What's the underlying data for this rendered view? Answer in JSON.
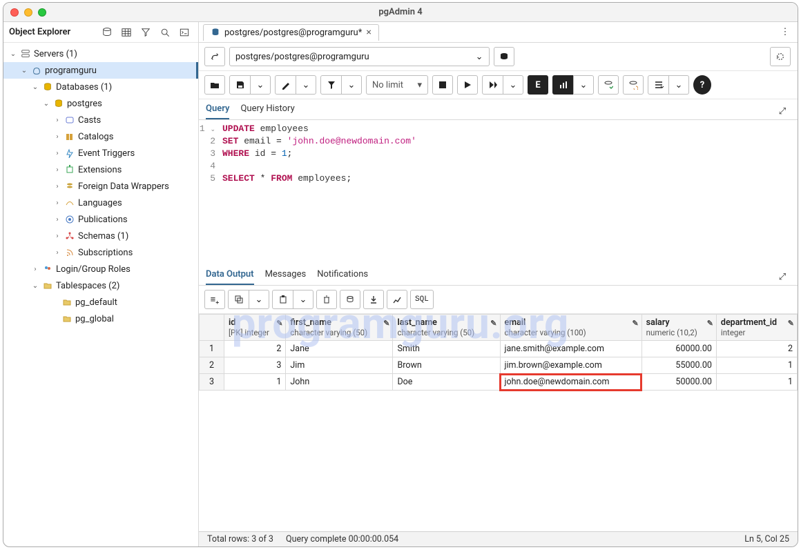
{
  "window": {
    "title": "pgAdmin 4"
  },
  "sidebar": {
    "title": "Object Explorer",
    "nodes": {
      "servers": "Servers (1)",
      "server1": "programguru",
      "databases": "Databases (1)",
      "db": "postgres",
      "casts": "Casts",
      "catalogs": "Catalogs",
      "event_triggers": "Event Triggers",
      "extensions": "Extensions",
      "fdw": "Foreign Data Wrappers",
      "languages": "Languages",
      "publications": "Publications",
      "schemas": "Schemas (1)",
      "subscriptions": "Subscriptions",
      "login_roles": "Login/Group Roles",
      "tablespaces": "Tablespaces (2)",
      "ts_default": "pg_default",
      "ts_global": "pg_global"
    }
  },
  "tab": {
    "label": "postgres/postgres@programguru*"
  },
  "connection": {
    "value": "postgres/postgres@programguru"
  },
  "toolbar": {
    "nolimit": "No limit"
  },
  "editor_tabs": {
    "query": "Query",
    "history": "Query History"
  },
  "code": {
    "l1": {
      "kw1": "UPDATE",
      "rest": " employees"
    },
    "l2": {
      "kw1": "SET",
      "mid": " email ",
      "op": "=",
      "sp": " ",
      "str": "'john.doe@newdomain.com'"
    },
    "l3": {
      "kw1": "WHERE",
      "mid": " id ",
      "op": "=",
      "sp": " ",
      "num": "1",
      "semi": ";"
    },
    "l5": {
      "kw1": "SELECT",
      "star": " * ",
      "kw2": "FROM",
      "rest": " employees",
      "semi": ";"
    }
  },
  "watermark": "programguru.org",
  "output_tabs": {
    "data": "Data Output",
    "messages": "Messages",
    "notifications": "Notifications"
  },
  "output_toolbar": {
    "sql": "SQL"
  },
  "columns": {
    "id": {
      "name": "id",
      "type": "[PK] integer"
    },
    "first_name": {
      "name": "first_name",
      "type": "character varying (50)"
    },
    "last_name": {
      "name": "last_name",
      "type": "character varying (50)"
    },
    "email": {
      "name": "email",
      "type": "character varying (100)"
    },
    "salary": {
      "name": "salary",
      "type": "numeric (10,2)"
    },
    "department_id": {
      "name": "department_id",
      "type": "integer"
    }
  },
  "rows": [
    {
      "n": "1",
      "id": "2",
      "first": "Jane",
      "last": "Smith",
      "email": "jane.smith@example.com",
      "salary": "60000.00",
      "dept": "2"
    },
    {
      "n": "2",
      "id": "3",
      "first": "Jim",
      "last": "Brown",
      "email": "jim.brown@example.com",
      "salary": "55000.00",
      "dept": "1"
    },
    {
      "n": "3",
      "id": "1",
      "first": "John",
      "last": "Doe",
      "email": "john.doe@newdomain.com",
      "salary": "50000.00",
      "dept": "1"
    }
  ],
  "status": {
    "rows": "Total rows: 3 of 3",
    "time": "Query complete 00:00:00.054",
    "pos": "Ln 5, Col 25"
  }
}
